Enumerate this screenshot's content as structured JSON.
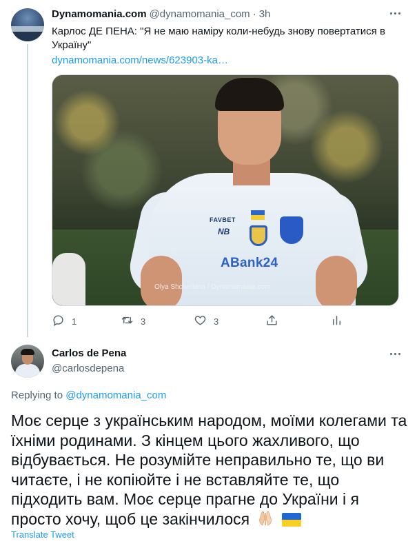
{
  "parent_tweet": {
    "display_name": "Dynamomania.com",
    "handle": "@dynamomania_com",
    "separator": "·",
    "time": "3h",
    "text": "Карлос ДЕ ПЕНА: \"Я не маю наміру коли-небудь знову повертатися в Україну\"",
    "link": "dynamomania.com/news/623903-ka…",
    "photo": {
      "jersey_brand_1": "FAVBET",
      "jersey_brand_2": "NB",
      "sponsor": "ABank24",
      "watermark": "Olya Shcherbina / Dynamomania.com"
    },
    "actions": {
      "reply_count": "1",
      "retweet_count": "3",
      "like_count": "3",
      "share_label": "",
      "analytics_label": ""
    }
  },
  "main_tweet": {
    "display_name": "Carlos de Pena",
    "handle": "@carlosdepena",
    "replying_prefix": "Replying to ",
    "replying_handle": "@dynamomania_com",
    "text": "Моє серце з українським народом, моїми колегами та їхніми родинами.  З кінцем цього жахливого, що відбувається.  Не розумійте неправильно те, що ви читаєте, і не копіюйте і не вставляйте те, що підходить вам.  Моє серце прагне до України і я просто хочу, щоб це закінчилося",
    "emojis": [
      "folded-hands",
      "ukraine-flag"
    ],
    "translate_label": "Translate Tweet"
  },
  "colors": {
    "link": "#1d9bf0",
    "secondary_text": "#536471",
    "primary_text": "#0f1419",
    "thread_line": "#cfd9de"
  }
}
